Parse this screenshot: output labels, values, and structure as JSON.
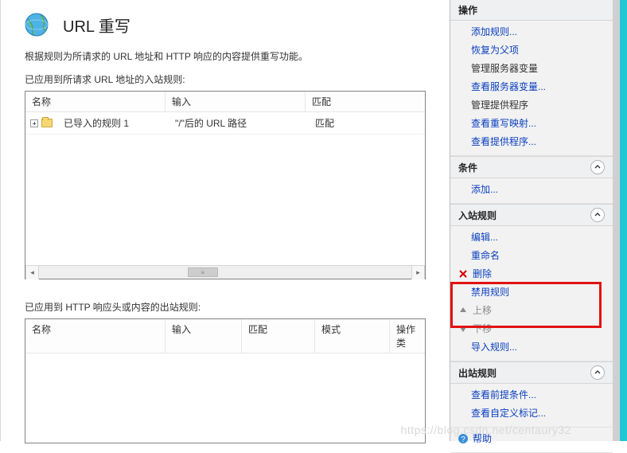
{
  "page": {
    "title": "URL 重写",
    "description": "根据规则为所请求的 URL 地址和 HTTP 响应的内容提供重写功能。",
    "section_inbound": "已应用到所请求 URL 地址的入站规则:",
    "section_outbound": "已应用到 HTTP 响应头或内容的出站规则:"
  },
  "inbound_table": {
    "headers": {
      "name": "名称",
      "input": "输入",
      "match": "匹配"
    },
    "rows": [
      {
        "name": "已导入的规则 1",
        "input": "\"/\"后的 URL 路径",
        "match": "匹配"
      }
    ]
  },
  "outbound_table": {
    "headers": {
      "name": "名称",
      "input": "输入",
      "match": "匹配",
      "mode": "模式",
      "opt": "操作类"
    },
    "rows": []
  },
  "actions": {
    "header": "操作",
    "groups": [
      {
        "items": [
          {
            "label": "添加规则...",
            "icon": "",
            "disabled": false
          },
          {
            "label": "恢复为父项",
            "icon": "",
            "disabled": false
          },
          {
            "label": "管理服务器变量",
            "icon": "",
            "disabled": false,
            "plain": true
          },
          {
            "label": "查看服务器变量...",
            "icon": "",
            "disabled": false
          },
          {
            "label": "管理提供程序",
            "icon": "",
            "disabled": false,
            "plain": true
          },
          {
            "label": "查看重写映射...",
            "icon": "",
            "disabled": false
          },
          {
            "label": "查看提供程序...",
            "icon": "",
            "disabled": false
          }
        ]
      },
      {
        "title": "条件",
        "items": [
          {
            "label": "添加...",
            "icon": "",
            "disabled": false
          }
        ]
      },
      {
        "title": "入站规则",
        "items": [
          {
            "label": "编辑...",
            "icon": "",
            "disabled": false
          },
          {
            "label": "重命名",
            "icon": "",
            "disabled": false
          },
          {
            "label": "删除",
            "icon": "x",
            "disabled": false
          },
          {
            "label": "禁用规则",
            "icon": "",
            "disabled": false
          },
          {
            "label": "上移",
            "icon": "up",
            "disabled": true
          },
          {
            "label": "下移",
            "icon": "down",
            "disabled": true
          },
          {
            "label": "导入规则...",
            "icon": "",
            "disabled": false
          }
        ]
      },
      {
        "title": "出站规则",
        "items": [
          {
            "label": "查看前提条件...",
            "icon": "",
            "disabled": false
          },
          {
            "label": "查看自定义标记...",
            "icon": "",
            "disabled": false
          }
        ]
      },
      {
        "items": [
          {
            "label": "帮助",
            "icon": "help",
            "disabled": false
          }
        ]
      }
    ]
  },
  "watermark": "https://blog.csdn.net/centaury32"
}
